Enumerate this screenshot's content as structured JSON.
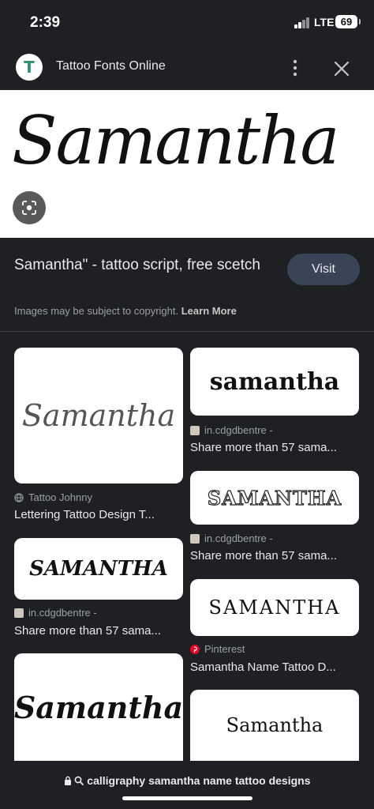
{
  "status_bar": {
    "time": "2:39",
    "network": "LTE",
    "battery": "69"
  },
  "header": {
    "logo_letter": "T",
    "site_name": "Tattoo Fonts Online"
  },
  "hero": {
    "image_text": "Samantha"
  },
  "info": {
    "title": "Samantha\" - tattoo script, free scetch",
    "visit_label": "Visit",
    "copyright_text": "Images may be subject to copyright.",
    "learn_more": "Learn More"
  },
  "results": [
    {
      "image_text": "Samantha",
      "source": "Tattoo Johnny",
      "title": "Lettering Tattoo Design T..."
    },
    {
      "image_text": "samantha",
      "source": "in.cdgdbentre -",
      "title": "Share more than 57 sama..."
    },
    {
      "image_text": "SAMANTHA",
      "source": "in.cdgdbentre -",
      "title": "Share more than 57 sama..."
    },
    {
      "image_text": "SAMANTHA",
      "source": "in.cdgdbentre -",
      "title": "Share more than 57 sama..."
    },
    {
      "image_text": "SAMANTHA",
      "source": "Pinterest",
      "title": "Samantha Name Tattoo D..."
    },
    {
      "image_text": "Samantha",
      "source": "",
      "title": ""
    },
    {
      "image_text": "Samantha",
      "source": "",
      "title": ""
    }
  ],
  "bottom_bar": {
    "url": "calligraphy samantha name tattoo designs"
  },
  "colors": {
    "background": "#1f2023",
    "visit_button": "#394457",
    "pinterest": "#e60023",
    "logo_green": "#2f8f6e"
  }
}
